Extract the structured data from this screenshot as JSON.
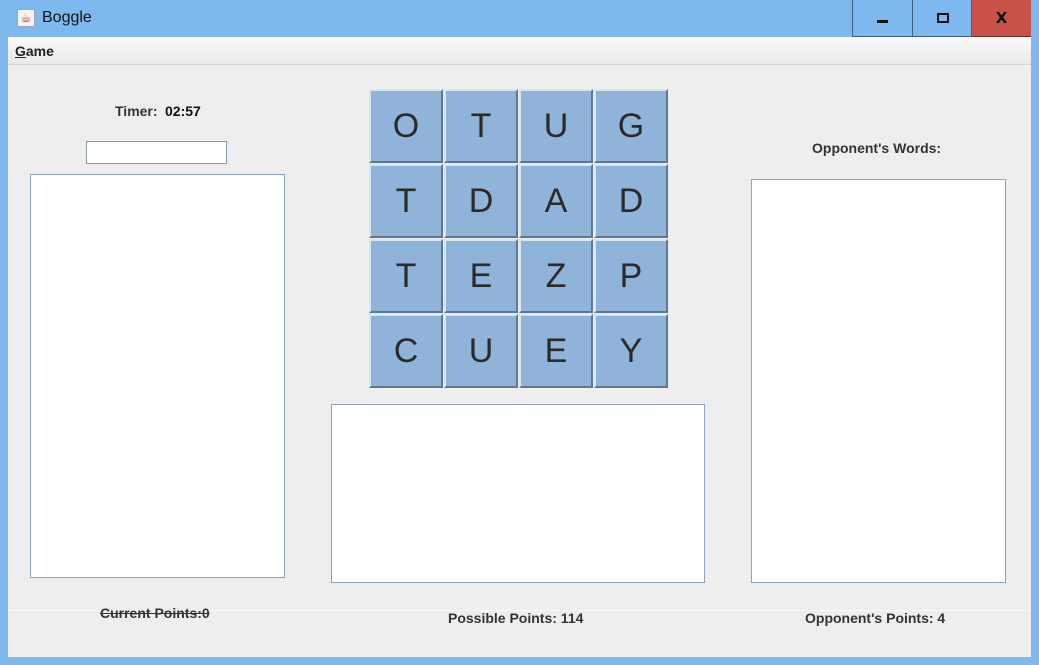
{
  "window": {
    "title": "Boggle",
    "app_icon": "java-cup-icon",
    "controls": {
      "minimize_icon": "minimize-icon",
      "maximize_icon": "maximize-icon",
      "close_glyph": "X"
    }
  },
  "menubar": {
    "items": [
      {
        "label": "Game"
      }
    ]
  },
  "timer": {
    "label": "Timer:",
    "value": "02:57"
  },
  "word_input": {
    "value": "",
    "placeholder": ""
  },
  "board": {
    "rows": [
      [
        "O",
        "T",
        "U",
        "G"
      ],
      [
        "T",
        "D",
        "A",
        "D"
      ],
      [
        "T",
        "E",
        "Z",
        "P"
      ],
      [
        "C",
        "U",
        "E",
        "Y"
      ]
    ]
  },
  "opponent": {
    "words_label": "Opponent's Words:",
    "points_label": "Opponent's Points: 4"
  },
  "scores": {
    "current_points": "Current Points:0",
    "possible_points": "Possible Points: 114"
  },
  "colors": {
    "titlebar": "#7fb8ef",
    "close_button": "#c8524a",
    "tile": "#8fb3d9",
    "client_background": "#eeeeee"
  }
}
